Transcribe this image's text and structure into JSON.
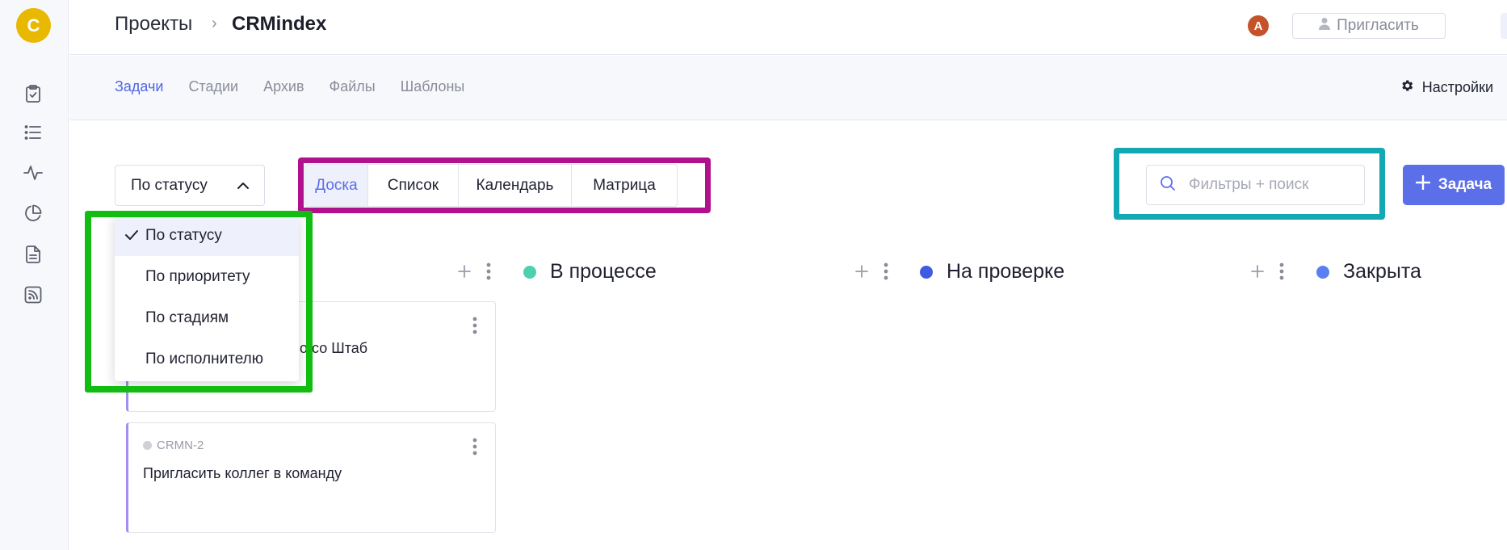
{
  "workspace": {
    "avatar_letter": "C",
    "avatar_color": "#e8b900"
  },
  "rail": {
    "icons": [
      "clipboard-check-icon",
      "list-icon",
      "activity-icon",
      "pie-chart-icon",
      "document-icon",
      "rss-icon"
    ]
  },
  "header": {
    "breadcrumb_root": "Проекты",
    "breadcrumb_sep": "›",
    "project_name": "CRMindex",
    "member_avatar_letter": "A",
    "invite_label": "Пригласить",
    "user_avatar_letter": "A"
  },
  "subnav": {
    "tabs": [
      {
        "label": "Задачи",
        "active": true
      },
      {
        "label": "Стадии",
        "active": false
      },
      {
        "label": "Архив",
        "active": false
      },
      {
        "label": "Файлы",
        "active": false
      },
      {
        "label": "Шаблоны",
        "active": false
      }
    ],
    "settings_label": "Настройки"
  },
  "toolbar": {
    "group_by_value": "По статусу",
    "views": [
      {
        "label": "Доска",
        "active": true
      },
      {
        "label": "Список",
        "active": false
      },
      {
        "label": "Календарь",
        "active": false
      },
      {
        "label": "Матрица",
        "active": false
      }
    ],
    "search_placeholder": "Фильтры + поиск",
    "add_task_label": "Задача"
  },
  "group_menu": {
    "items": [
      {
        "label": "По статусу",
        "selected": true
      },
      {
        "label": "По приоритету",
        "selected": false
      },
      {
        "label": "По стадиям",
        "selected": false
      },
      {
        "label": "По исполнителю",
        "selected": false
      }
    ]
  },
  "columns": [
    {
      "title": "В процессе",
      "color": "#4dcfb0"
    },
    {
      "title": "На проверке",
      "color": "#3f5be0"
    },
    {
      "title": "Закрыта",
      "color": "#5b7ef0"
    }
  ],
  "cards": [
    {
      "id": "",
      "title_partial": "о со Штаб"
    },
    {
      "id": "CRMN-2",
      "title": "Пригласить коллег в команду"
    }
  ],
  "colors": {
    "accent": "#5b6fe8",
    "highlight_magenta": "#b0128e",
    "highlight_teal": "#12a9b5",
    "highlight_green": "#10bd10",
    "card_border_accent": "#a48cf0"
  }
}
